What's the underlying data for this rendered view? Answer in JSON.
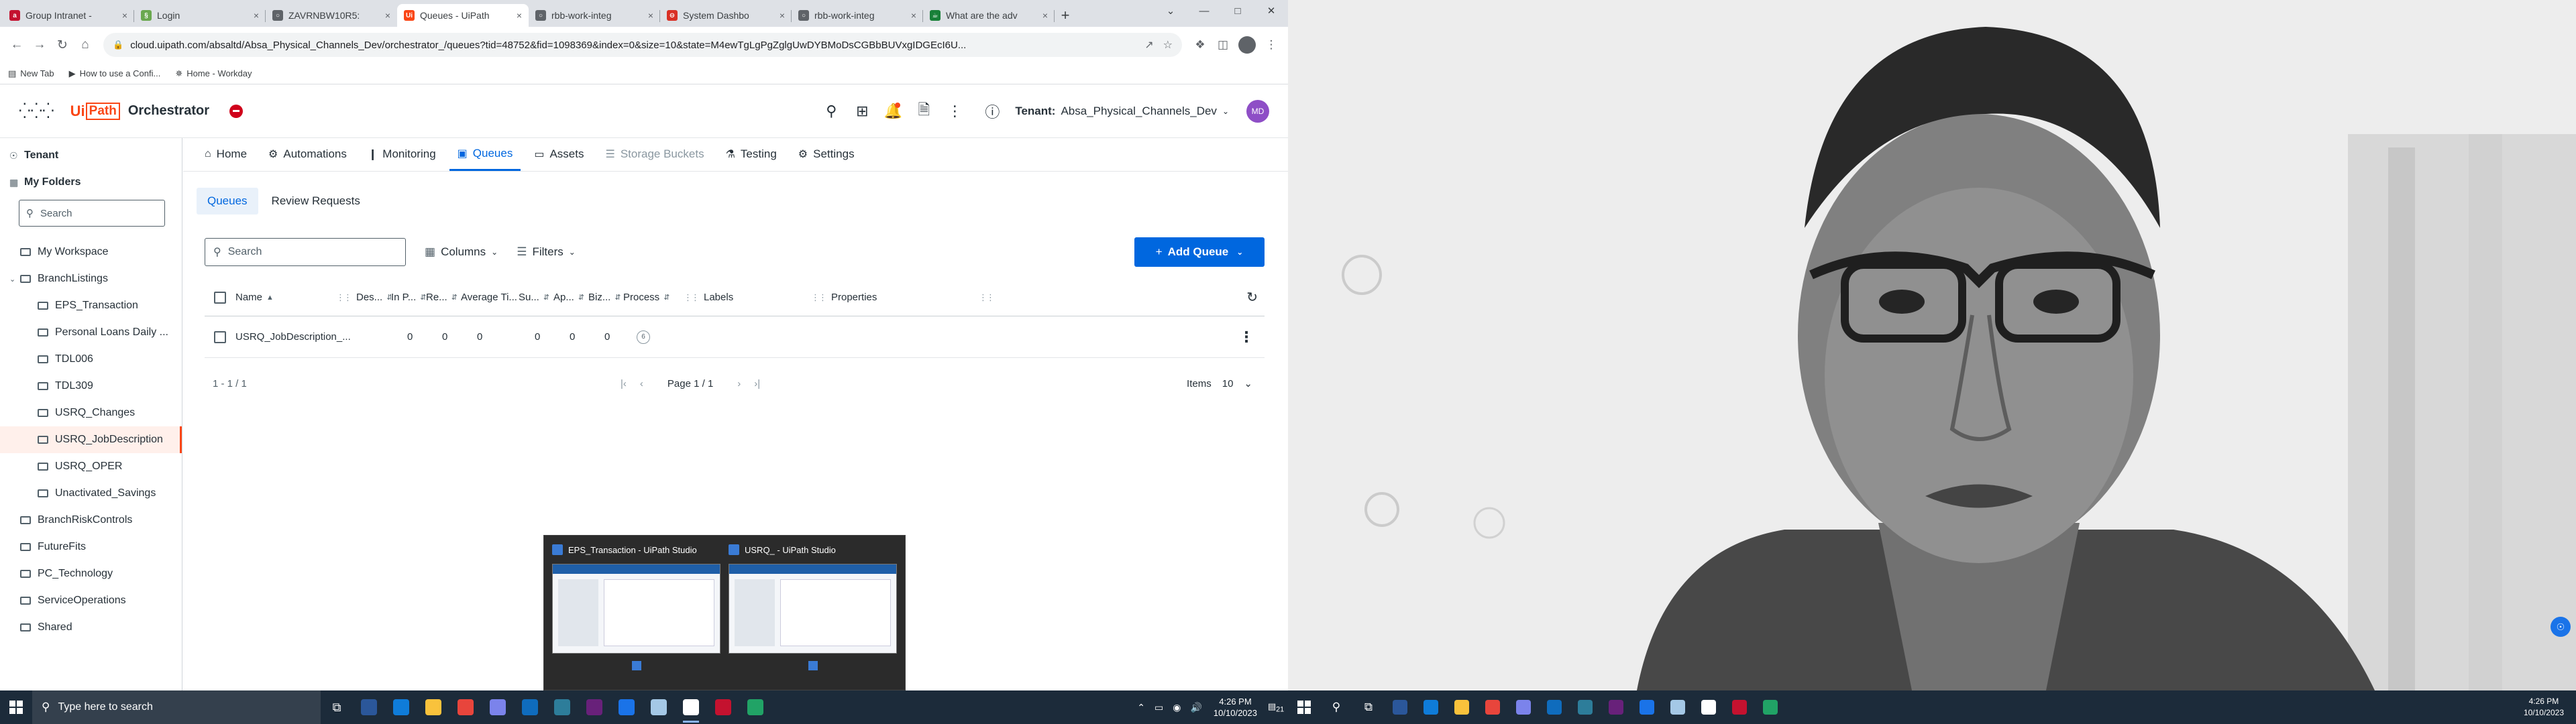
{
  "browser": {
    "tabs": [
      {
        "title": "Group Intranet -",
        "color": "#c4122f",
        "glyph": "a"
      },
      {
        "title": "Login",
        "color": "#6aa84f",
        "glyph": "§"
      },
      {
        "title": "ZAVRNBW10R5:",
        "color": "#5f6368",
        "glyph": "○"
      },
      {
        "title": "Queues - UiPath",
        "color": "#fa4616",
        "glyph": "Ui"
      },
      {
        "title": "rbb-work-integ",
        "color": "#5f6368",
        "glyph": "○"
      },
      {
        "title": "System Dashbo",
        "color": "#d93025",
        "glyph": "⊖"
      },
      {
        "title": "rbb-work-integ",
        "color": "#5f6368",
        "glyph": "○"
      },
      {
        "title": "What are the adv",
        "color": "#188038",
        "glyph": "☕"
      }
    ],
    "url": "cloud.uipath.com/absaltd/Absa_Physical_Channels_Dev/orchestrator_/queues?tid=48752&fid=1098369&index=0&size=10&state=M4ewTgLgPgZglgUwDYBMoDsCGBbBUVxgIDGEcI6U...",
    "bookmarks": [
      {
        "label": "New Tab",
        "icon": "▤"
      },
      {
        "label": "How to use a Confi...",
        "icon": "▶"
      },
      {
        "label": "Home - Workday",
        "icon": "✵"
      }
    ]
  },
  "app": {
    "logo_ui": "Ui",
    "logo_path": "Path",
    "product": "Orchestrator",
    "tenant_label": "Tenant:",
    "tenant_value": "Absa_Physical_Channels_Dev",
    "user_initials": "MD"
  },
  "sidebar": {
    "tenant": "Tenant",
    "my_folders": "My Folders",
    "search_placeholder": "Search",
    "folders": [
      {
        "label": "My Workspace",
        "level": 0,
        "chev": ""
      },
      {
        "label": "BranchListings",
        "level": 0,
        "chev": "⌄"
      },
      {
        "label": "EPS_Transaction",
        "level": 1,
        "chev": ""
      },
      {
        "label": "Personal Loans Daily ...",
        "level": 1,
        "chev": ""
      },
      {
        "label": "TDL006",
        "level": 1,
        "chev": ""
      },
      {
        "label": "TDL309",
        "level": 1,
        "chev": ""
      },
      {
        "label": "USRQ_Changes",
        "level": 1,
        "chev": ""
      },
      {
        "label": "USRQ_JobDescription",
        "level": 1,
        "chev": "",
        "selected": true
      },
      {
        "label": "USRQ_OPER",
        "level": 1,
        "chev": ""
      },
      {
        "label": "Unactivated_Savings",
        "level": 1,
        "chev": ""
      },
      {
        "label": "BranchRiskControls",
        "level": 0,
        "chev": ""
      },
      {
        "label": "FutureFits",
        "level": 0,
        "chev": ""
      },
      {
        "label": "PC_Technology",
        "level": 0,
        "chev": ""
      },
      {
        "label": "ServiceOperations",
        "level": 0,
        "chev": ""
      },
      {
        "label": "Shared",
        "level": 0,
        "chev": ""
      }
    ]
  },
  "nav": {
    "items": [
      {
        "label": "Home",
        "icon": "⌂"
      },
      {
        "label": "Automations",
        "icon": "⚙"
      },
      {
        "label": "Monitoring",
        "icon": "❙"
      },
      {
        "label": "Queues",
        "icon": "▣"
      },
      {
        "label": "Assets",
        "icon": "▭"
      },
      {
        "label": "Storage Buckets",
        "icon": "☰"
      },
      {
        "label": "Testing",
        "icon": "⚗"
      },
      {
        "label": "Settings",
        "icon": "⚙"
      }
    ],
    "active": "Queues"
  },
  "subtabs": [
    "Queues",
    "Review Requests"
  ],
  "toolbar": {
    "search_placeholder": "Search",
    "columns": "Columns",
    "filters": "Filters",
    "add_queue": "Add Queue"
  },
  "grid": {
    "columns": [
      "Name",
      "Des...",
      "In P...",
      "Re...",
      "Average Ti...",
      "Su...",
      "Ap...",
      "Biz...",
      "Process",
      "Labels",
      "Properties"
    ],
    "rows": [
      [
        "USRQ_JobDescription_...",
        "",
        "0",
        "0",
        "0",
        "0",
        "0",
        "0",
        "6",
        "",
        ""
      ]
    ]
  },
  "pager": {
    "range": "1 - 1 / 1",
    "page": "Page 1 / 1",
    "items_label": "Items",
    "items_value": "10"
  },
  "thumbnails": [
    {
      "title": "EPS_Transaction - UiPath Studio"
    },
    {
      "title": "USRQ_ - UiPath Studio"
    }
  ],
  "taskbar": {
    "search_placeholder": "Type here to search",
    "time": "4:26 PM",
    "date": "10/10/2023",
    "notif_count": "21",
    "apps": [
      "#2b579a",
      "#0f7cd9",
      "#f9c23c",
      "#e8453c",
      "#7b83eb",
      "#0f6cbd",
      "#2d7d9a",
      "#68217a",
      "#1a73e8",
      "#a4c8e6",
      "#ffffff",
      "#c4122f",
      "#21a366"
    ]
  },
  "right_screen": {
    "time": "4:26 PM",
    "date": "10/10/2023"
  }
}
